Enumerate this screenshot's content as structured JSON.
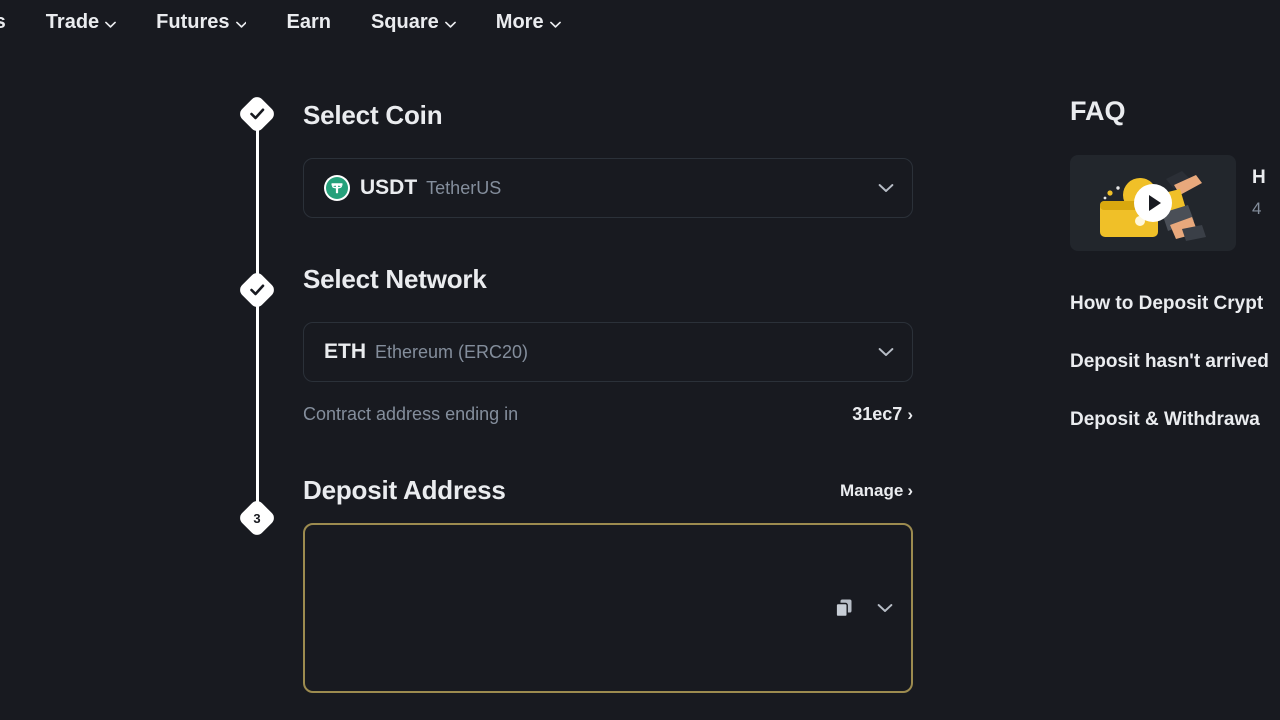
{
  "nav": {
    "items": [
      {
        "label": "ts",
        "has_caret": false,
        "clipped": true
      },
      {
        "label": "Trade",
        "has_caret": true
      },
      {
        "label": "Futures",
        "has_caret": true
      },
      {
        "label": "Earn",
        "has_caret": false
      },
      {
        "label": "Square",
        "has_caret": true
      },
      {
        "label": "More",
        "has_caret": true
      }
    ]
  },
  "steps": [
    {
      "marker": "check",
      "title": "Select Coin"
    },
    {
      "marker": "check",
      "title": "Select Network"
    },
    {
      "marker": "3",
      "title": "Deposit Address"
    }
  ],
  "coin": {
    "icon": "usdt-tether-icon",
    "symbol": "USDT",
    "name": "TetherUS",
    "chevron": "chevron-down-icon"
  },
  "network": {
    "symbol": "ETH",
    "name": "Ethereum (ERC20)",
    "chevron": "chevron-down-icon"
  },
  "contract": {
    "label": "Contract address ending in",
    "value": "31ec7",
    "caret": "›"
  },
  "deposit_address": {
    "title": "Deposit Address",
    "manage_label": "Manage",
    "manage_caret": "›",
    "value_masked": "",
    "copy_icon": "copy-icon",
    "chevron": "chevron-down-icon"
  },
  "faq": {
    "title": "FAQ",
    "video": {
      "title": "H",
      "duration": "4",
      "play_icon": "play-icon",
      "thumbnail": "deposit-wallet-illustration"
    },
    "links": [
      "How to Deposit Crypt",
      "Deposit hasn't arrived",
      "Deposit & Withdrawa"
    ]
  },
  "colors": {
    "background": "#181a20",
    "text_primary": "#eaecef",
    "text_secondary": "#848e9c",
    "border": "#2b3139",
    "accent_gold": "#9c8b4f",
    "usdt_green": "#26a17b",
    "brand_yellow": "#f0b90b"
  }
}
